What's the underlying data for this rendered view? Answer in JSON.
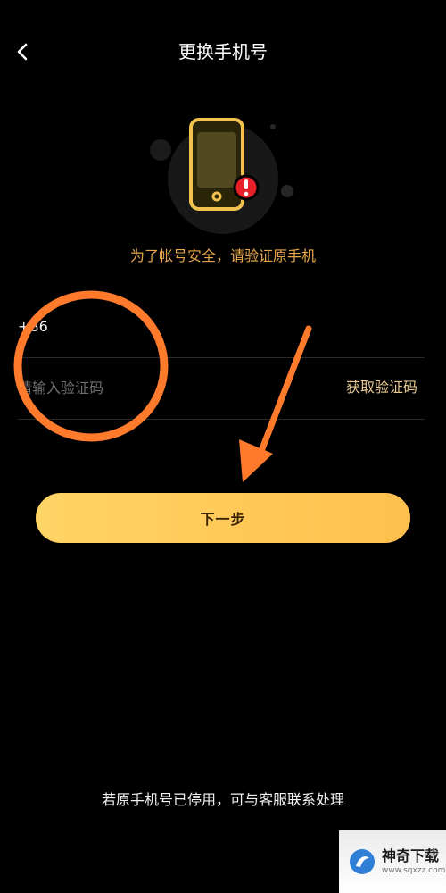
{
  "header": {
    "title": "更换手机号",
    "back_icon": "chevron-left-icon"
  },
  "illustration": {
    "phone_icon": "smartphone-icon",
    "alert_icon": "alert-circle-icon",
    "accent_color": "#f2c14e",
    "alert_color": "#e8202a"
  },
  "security_tip": "为了帐号安全，请验证原手机",
  "form": {
    "country_code": "+86",
    "code_placeholder": "请输入验证码",
    "code_value": "",
    "get_code_label": "获取验证码"
  },
  "next_button_label": "下一步",
  "footer_note": "若原手机号已停用，可与客服联系处理",
  "annotations": {
    "circle_color": "#ff7a2b",
    "arrow_color": "#ff7a2b"
  },
  "watermark": {
    "name": "神奇下载",
    "url": "www.sqxzz.com"
  }
}
